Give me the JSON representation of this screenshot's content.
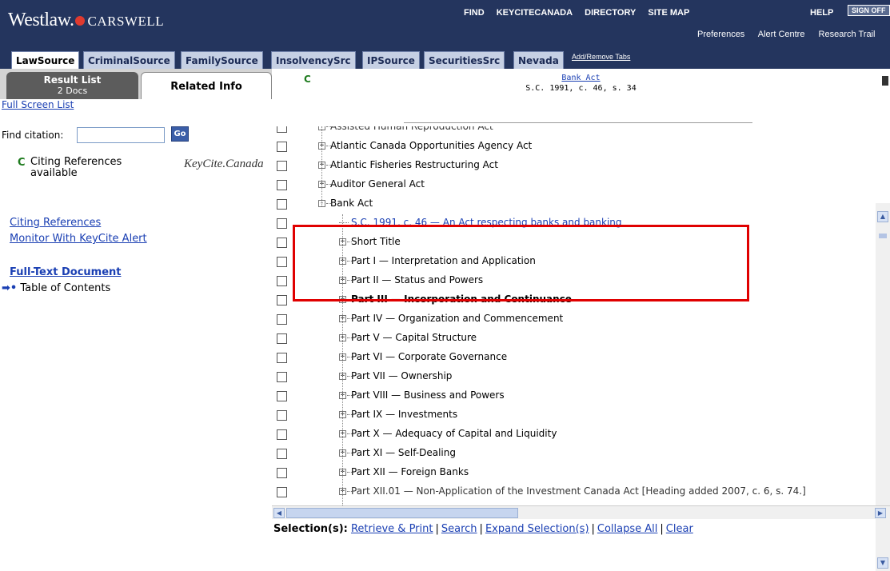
{
  "header": {
    "logo_westlaw": "Westlaw.",
    "logo_carswell": "CARSWELL",
    "nav": [
      "FIND",
      "KEYCITECANADA",
      "DIRECTORY",
      "SITE MAP"
    ],
    "help": "HELP",
    "signoff": "SIGN OFF",
    "subnav": [
      "Preferences",
      "Alert Centre",
      "Research Trail"
    ]
  },
  "tabs": [
    {
      "label": "LawSource",
      "active": true
    },
    {
      "label": "CriminalSource"
    },
    {
      "label": "FamilySource"
    },
    {
      "label": "InsolvencySrc"
    },
    {
      "label": "IPSource"
    },
    {
      "label": "SecuritiesSrc"
    },
    {
      "label": "Nevada"
    }
  ],
  "add_remove_tabs": "Add/Remove Tabs",
  "left": {
    "result_list_label": "Result List",
    "result_list_count": "2 Docs",
    "related_info_label": "Related Info",
    "full_screen_list": "Full Screen List",
    "find_citation_label": "Find citation:",
    "find_citation_value": "",
    "go_label": "Go",
    "keycite_flag": "C",
    "citing_text_1": "Citing References",
    "citing_text_2": "available",
    "keycite_logo": "KeyCite.Canada",
    "citing_references_link": "Citing References",
    "monitor_link": "Monitor With KeyCite Alert",
    "full_text_link": "Full-Text Document",
    "toc_label": "Table of Contents"
  },
  "main": {
    "flag": "C",
    "doc_title": "Bank Act",
    "doc_citation": "S.C. 1991, c. 46, s. 34",
    "tree": [
      {
        "label": "Assisted Human Reproduction Act",
        "level": 0,
        "expander": "+",
        "partial": true
      },
      {
        "label": "Atlantic Canada Opportunities Agency Act",
        "level": 0,
        "expander": "+"
      },
      {
        "label": "Atlantic Fisheries Restructuring Act",
        "level": 0,
        "expander": "+"
      },
      {
        "label": "Auditor General Act",
        "level": 0,
        "expander": "+"
      },
      {
        "label": "Bank Act",
        "level": 0,
        "expander": "-"
      },
      {
        "label": "S.C. 1991, c. 46 — An Act respecting banks and banking",
        "level": 1,
        "expander": "",
        "link": true
      },
      {
        "label": "Short Title",
        "level": 1,
        "expander": "+"
      },
      {
        "label": "Part I — Interpretation and Application",
        "level": 1,
        "expander": "+"
      },
      {
        "label": "Part II — Status and Powers",
        "level": 1,
        "expander": "+"
      },
      {
        "label": "Part III — Incorporation and Continuance",
        "level": 1,
        "expander": "+",
        "bold": true
      },
      {
        "label": "Part IV — Organization and Commencement",
        "level": 1,
        "expander": "+"
      },
      {
        "label": "Part V — Capital Structure",
        "level": 1,
        "expander": "+"
      },
      {
        "label": "Part VI — Corporate Governance",
        "level": 1,
        "expander": "+"
      },
      {
        "label": "Part VII — Ownership",
        "level": 1,
        "expander": "+"
      },
      {
        "label": "Part VIII — Business and Powers",
        "level": 1,
        "expander": "+"
      },
      {
        "label": "Part IX — Investments",
        "level": 1,
        "expander": "+"
      },
      {
        "label": "Part X — Adequacy of Capital and Liquidity",
        "level": 1,
        "expander": "+"
      },
      {
        "label": "Part XI — Self-Dealing",
        "level": 1,
        "expander": "+"
      },
      {
        "label": "Part XII — Foreign Banks",
        "level": 1,
        "expander": "+"
      },
      {
        "label": "Part XII.01 — Non-Application of the Investment Canada Act [Heading added 2007, c. 6, s. 74.]",
        "level": 1,
        "expander": "+",
        "partial": true
      }
    ],
    "selection_label": "Selection(s):",
    "selection_actions": [
      "Retrieve & Print",
      "Search",
      "Expand Selection(s)",
      "Collapse All",
      "Clear"
    ]
  },
  "colors": {
    "header_bg": "#24355e",
    "link": "#1a3fb3",
    "highlight": "#e00000",
    "keycite_green": "#1e7b1e"
  }
}
